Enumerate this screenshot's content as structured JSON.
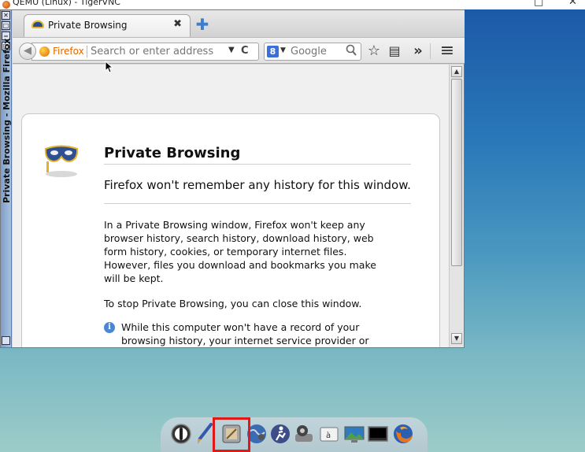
{
  "host": {
    "title": "QEMU (Linux) - TigerVNC",
    "minimize": "□",
    "close": "✕"
  },
  "window": {
    "vertical_title": "Private Browsing - Mozilla Firefox",
    "wm_buttons": [
      "✕",
      "□",
      "‒",
      "□"
    ]
  },
  "tab": {
    "label": "Private Browsing",
    "close": "✖",
    "new_tab": "✚"
  },
  "navbar": {
    "back": "◀",
    "identity": "Firefox",
    "url_placeholder": "Search or enter address",
    "dropmarker": "▼",
    "reload": "C",
    "search_engine_letter": "8",
    "search_engine_drop": "▼",
    "search_placeholder": "Google",
    "search_icon": "🔍",
    "bookmark_star": "☆",
    "reading_list": "▤",
    "overflow": "»",
    "menu": "≡"
  },
  "page": {
    "heading": "Private Browsing",
    "subtitle": "Firefox won't remember any history for this window.",
    "para1": "In a Private Browsing window, Firefox won't keep any browser history, search history, download history, web form history, cookies, or temporary internet files. However, files you download and bookmarks you make will be kept.",
    "para2": "To stop Private Browsing, you can close this window.",
    "info_icon": "i",
    "info_text": "While this computer won't have a record of your browsing history, your internet service provider or employer can still track the pages you visit."
  },
  "scrollbar": {
    "up": "▲",
    "down": "▼"
  },
  "dock": {
    "icons": [
      "power-icon",
      "paintbrush-icon",
      "settings-panel-icon",
      "globe-icon",
      "running-man-icon",
      "webcam-icon",
      "text-editor-icon",
      "monitor-icon",
      "terminal-icon",
      "firefox-icon"
    ],
    "highlighted": "settings-panel-icon"
  },
  "colors": {
    "highlight": "#e01818",
    "desktop_top": "#1c5aa8",
    "desktop_bottom": "#9cccc8",
    "firefox_orange": "#e06800"
  }
}
